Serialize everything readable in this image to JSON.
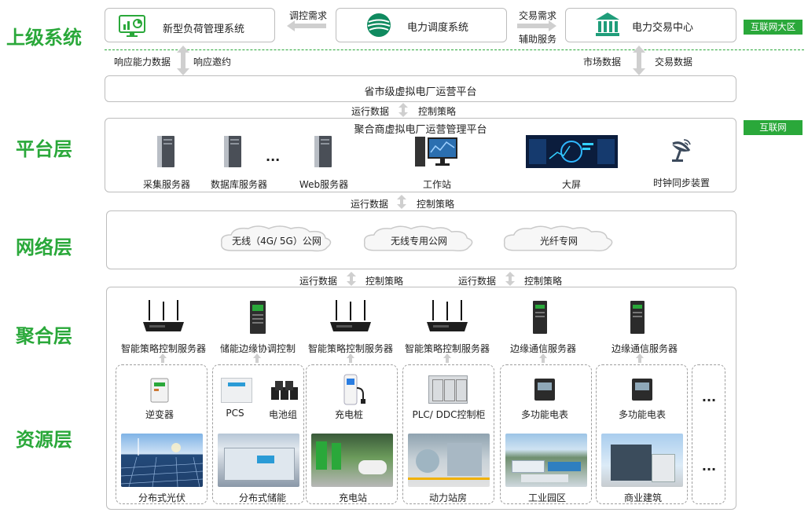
{
  "layers": [
    "上级系统",
    "平台层",
    "网络层",
    "聚合层",
    "资源层"
  ],
  "colors": {
    "accent": "#2aa83a",
    "border": "#bdbdbd",
    "arrow": "#cfcfcf"
  },
  "top": {
    "load_system": "新型负荷管理系统",
    "dispatch_system": "电力调度系统",
    "trade_center": "电力交易中心",
    "regulate_demand": "调控需求",
    "trade_demand": "交易需求",
    "aux_service": "辅助服务",
    "response_capacity": "响应能力数据",
    "response_invite": "响应邀约",
    "market_data": "市场数据",
    "trade_data": "交易数据",
    "zone_tag": "互联网大区"
  },
  "province_platform": "省市级虚拟电厂运营平台",
  "link1": {
    "left": "运行数据",
    "right": "控制策略"
  },
  "platform": {
    "title": "聚合商虚拟电厂运营管理平台",
    "tag": "互联网",
    "items": [
      "采集服务器",
      "数据库服务器",
      "Web服务器",
      "工作站",
      "大屏",
      "时钟同步装置"
    ],
    "ellipsis": "..."
  },
  "link2": {
    "left": "运行数据",
    "right": "控制策略"
  },
  "network": {
    "clouds": [
      "无线（4G/ 5G）公网",
      "无线专用公网",
      "光纤专网"
    ]
  },
  "link3": [
    {
      "left": "运行数据",
      "right": "控制策略"
    },
    {
      "left": "运行数据",
      "right": "控制策略"
    }
  ],
  "aggregation": {
    "devices": [
      "智能策略控制服务器",
      "储能边缘协调控制",
      "智能策略控制服务器",
      "智能策略控制服务器",
      "边缘通信服务器",
      "边缘通信服务器"
    ]
  },
  "resource": {
    "groups": [
      {
        "device": "逆变器",
        "site": "分布式光伏"
      },
      {
        "device": "PCS",
        "device2": "电池组",
        "site": "分布式储能"
      },
      {
        "device": "充电桩",
        "site": "充电站"
      },
      {
        "device": "PLC/ DDC控制柜",
        "site": "动力站房"
      },
      {
        "device": "多功能电表",
        "site": "工业园区"
      },
      {
        "device": "多功能电表",
        "site": "商业建筑"
      }
    ],
    "more": "..."
  }
}
